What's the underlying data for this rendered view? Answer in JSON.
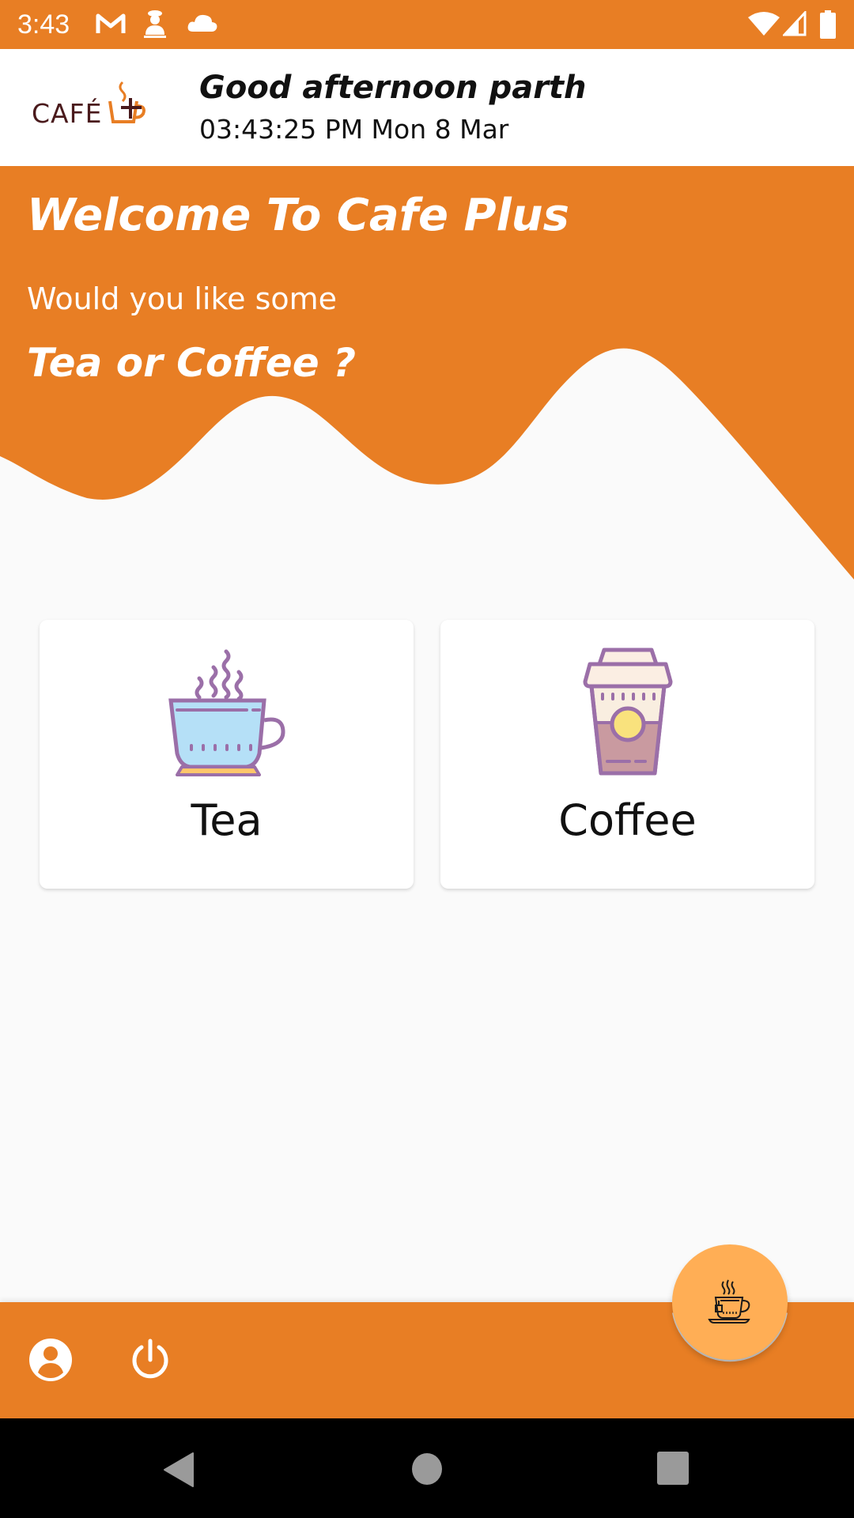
{
  "status_bar": {
    "time": "3:43",
    "icons": [
      "gmail-icon",
      "app-notification-icon",
      "cloud-icon",
      "wifi-icon",
      "signal-icon",
      "battery-icon"
    ]
  },
  "header": {
    "logo_text": "CAFÉ",
    "greeting": "Good afternoon parth",
    "datetime": "03:43:25 PM  Mon 8 Mar"
  },
  "hero": {
    "title": "Welcome To Cafe Plus",
    "subtitle": "Would you like some",
    "question": "Tea or Coffee ?"
  },
  "options": [
    {
      "label": "Tea",
      "icon": "tea-cup-icon"
    },
    {
      "label": "Coffee",
      "icon": "coffee-cup-icon"
    }
  ],
  "bottom_bar": {
    "profile_icon": "account-circle-icon",
    "logout_icon": "power-icon",
    "fab_icon": "tea-cup-icon"
  },
  "nav_bar": {
    "back": "back-icon",
    "home": "home-icon",
    "recents": "recents-icon"
  },
  "colors": {
    "primary": "#e87e24",
    "fab": "#ffae55",
    "background": "#fafafa",
    "logo_text": "#4a1a1c"
  }
}
